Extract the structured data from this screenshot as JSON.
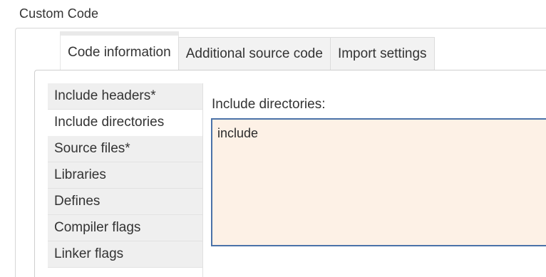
{
  "section": {
    "title": "Custom Code"
  },
  "tabs": [
    {
      "label": "Code information",
      "active": true
    },
    {
      "label": "Additional source code",
      "active": false
    },
    {
      "label": "Import settings",
      "active": false
    }
  ],
  "sidebar": {
    "items": [
      {
        "label": "Include headers*"
      },
      {
        "label": "Include directories",
        "selected": true
      },
      {
        "label": "Source files*"
      },
      {
        "label": "Libraries"
      },
      {
        "label": "Defines"
      },
      {
        "label": "Compiler flags"
      },
      {
        "label": "Linker flags"
      }
    ]
  },
  "pane": {
    "label": "Include directories:",
    "value": "include"
  },
  "colors": {
    "textarea_bg": "#fdf1e6",
    "textarea_border": "#4a72a8",
    "tab_bg": "#f2f2f2",
    "sidebar_bg": "#efefef"
  }
}
